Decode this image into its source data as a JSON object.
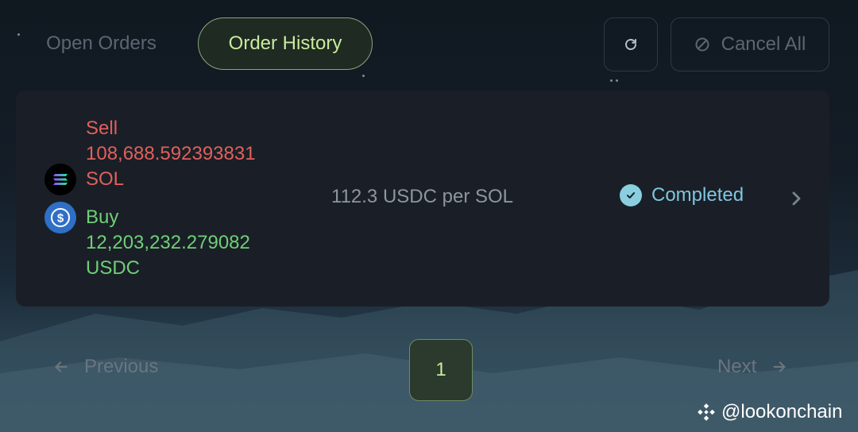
{
  "tabs": {
    "open_orders": "Open Orders",
    "order_history": "Order History"
  },
  "toolbar": {
    "refresh_icon": "refresh-icon",
    "cancel_all_label": "Cancel All",
    "cancel_icon": "ban-icon"
  },
  "order": {
    "sell": {
      "label": "Sell",
      "amount": "108,688.592393831",
      "token": "SOL",
      "icon": "solana-icon"
    },
    "buy": {
      "label": "Buy",
      "amount": "12,203,232.279082",
      "token": "USDC",
      "icon": "usdc-icon"
    },
    "price": "112.3 USDC per SOL",
    "status": "Completed",
    "status_icon": "check-circle-icon"
  },
  "pagination": {
    "previous": "Previous",
    "current_page": "1",
    "next": "Next"
  },
  "watermark": {
    "text": "@lookonchain",
    "icon": "binance-logo"
  },
  "colors": {
    "sell": "#e0605b",
    "buy": "#6fcf76",
    "accent": "#c8eb9d",
    "status": "#7fc6de",
    "card_bg": "#1a1f27"
  }
}
